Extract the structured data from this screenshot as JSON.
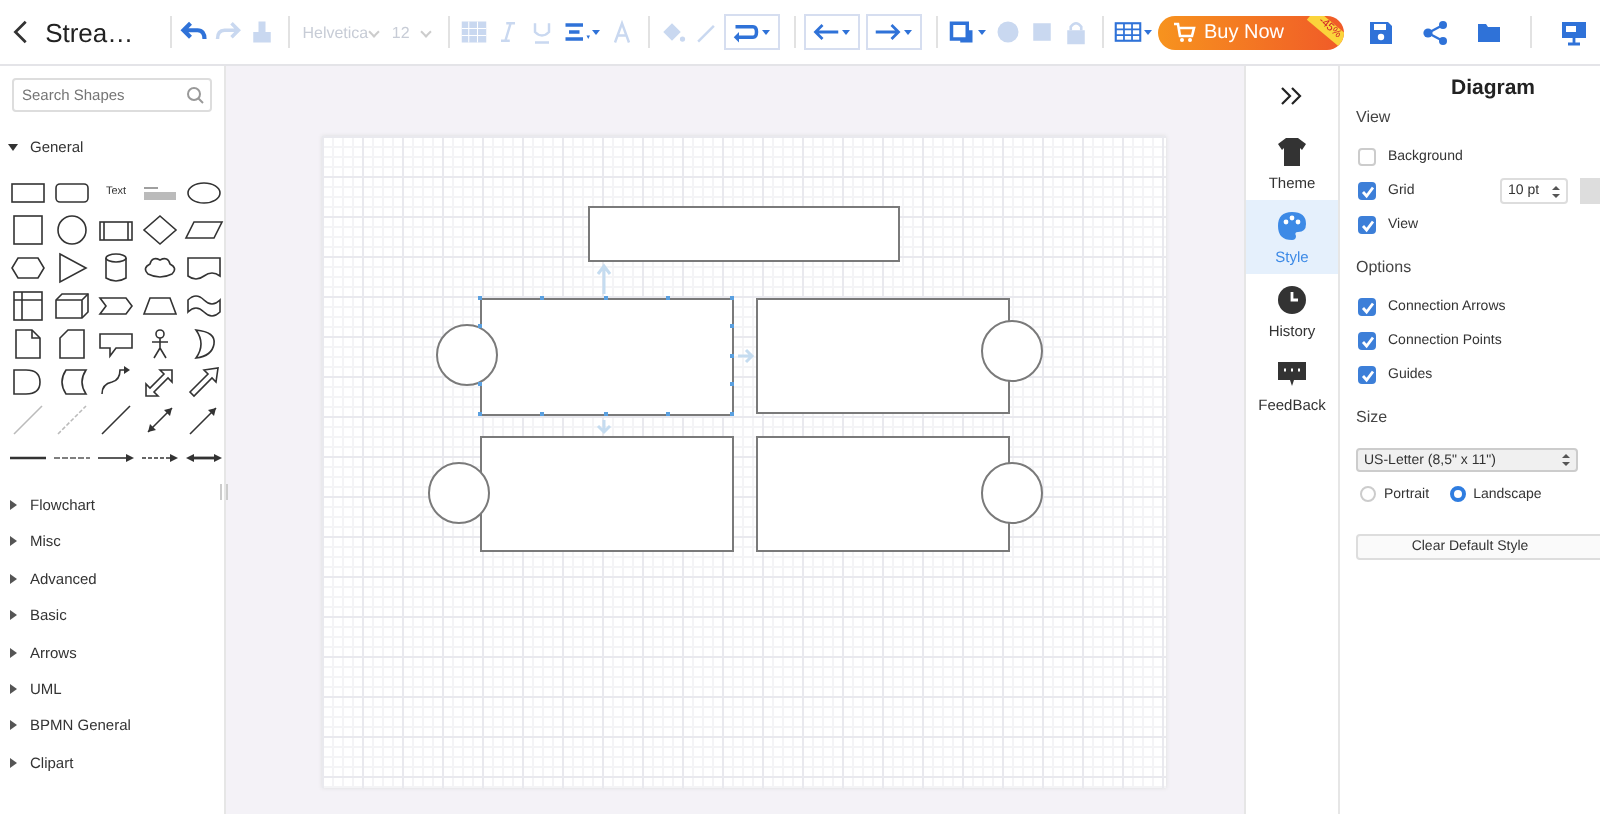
{
  "toolbar": {
    "title": "Strea…",
    "font": {
      "value": "Helvetica",
      "disabled": true
    },
    "font_size": {
      "value": "12",
      "disabled": true
    },
    "tools": [
      {
        "kind": "undo",
        "disabled": false
      },
      {
        "kind": "redo",
        "disabled": true
      },
      {
        "kind": "paint",
        "disabled": true
      },
      {
        "kind": "sep"
      },
      {
        "kind": "font"
      },
      {
        "kind": "sep"
      },
      {
        "kind": "fill",
        "disabled": true
      },
      {
        "kind": "italic",
        "disabled": true
      },
      {
        "kind": "underline",
        "disabled": true
      },
      {
        "kind": "align",
        "disabled": false
      },
      {
        "kind": "fontcolor",
        "disabled": true
      },
      {
        "kind": "sep"
      },
      {
        "kind": "bucket",
        "disabled": true
      },
      {
        "kind": "pen",
        "disabled": true
      },
      {
        "kind": "connector",
        "disabled": false
      },
      {
        "kind": "sep"
      },
      {
        "kind": "arrowleft",
        "disabled": false
      },
      {
        "kind": "arrowright",
        "disabled": false
      },
      {
        "kind": "sep"
      },
      {
        "kind": "arrange",
        "disabled": false
      },
      {
        "kind": "front",
        "disabled": true
      },
      {
        "kind": "back",
        "disabled": true
      },
      {
        "kind": "lock",
        "disabled": true
      },
      {
        "kind": "sep"
      },
      {
        "kind": "table",
        "disabled": false
      }
    ],
    "buy_button": "Buy Now",
    "discount_badge": "-45%"
  },
  "sidebar": {
    "search": {
      "placeholder": "Search Shapes"
    },
    "palette_text": "Text",
    "categories": [
      {
        "label": "General",
        "expanded": true
      },
      {
        "label": "Flowchart",
        "expanded": false
      },
      {
        "label": "Misc",
        "expanded": false
      },
      {
        "label": "Advanced",
        "expanded": false
      },
      {
        "label": "Basic",
        "expanded": false
      },
      {
        "label": "Arrows",
        "expanded": false
      },
      {
        "label": "UML",
        "expanded": false
      },
      {
        "label": "BPMN General",
        "expanded": false
      },
      {
        "label": "Clipart",
        "expanded": false
      }
    ]
  },
  "rail": {
    "tabs": [
      {
        "kind": "theme",
        "label": "Theme",
        "selected": false
      },
      {
        "kind": "style",
        "label": "Style",
        "selected": true
      },
      {
        "kind": "history",
        "label": "History",
        "selected": false
      },
      {
        "kind": "feedback",
        "label": "FeedBack",
        "selected": false
      }
    ]
  },
  "panel": {
    "title": "Diagram",
    "sections": [
      {
        "heading": "View",
        "options": [
          {
            "label": "Background",
            "checked": false
          },
          {
            "label": "Grid",
            "checked": true,
            "spacing": "10 pt"
          },
          {
            "label": "View",
            "checked": true
          }
        ]
      },
      {
        "heading": "Options",
        "options": [
          {
            "label": "Connection Arrows",
            "checked": true
          },
          {
            "label": "Connection Points",
            "checked": true
          },
          {
            "label": "Guides",
            "checked": true
          }
        ]
      }
    ],
    "size": {
      "heading": "Size",
      "paper": "US-Letter (8,5\" x 11\")",
      "orientations": [
        {
          "label": "Portrait",
          "selected": false
        },
        {
          "label": "Landscape",
          "selected": true
        }
      ]
    },
    "clear_button": "Clear Default Style"
  }
}
